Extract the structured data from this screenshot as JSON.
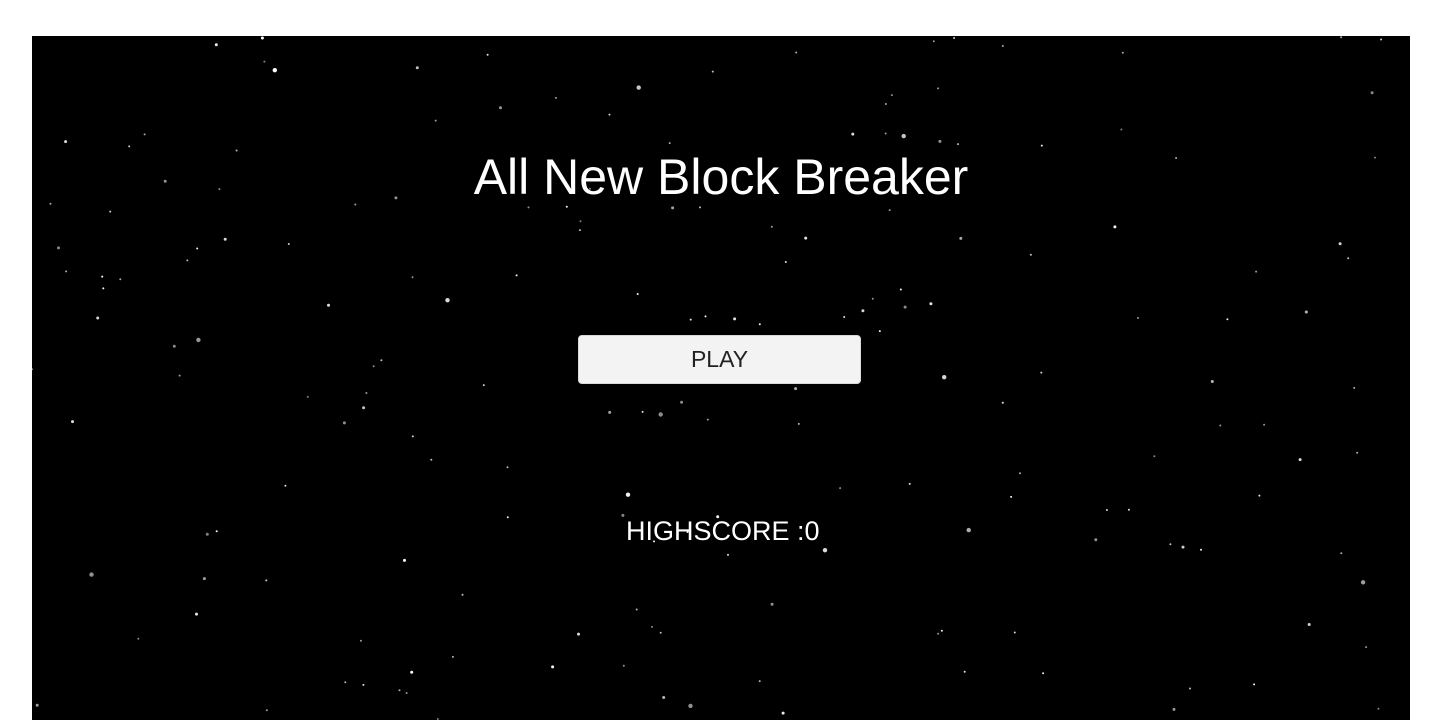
{
  "menu": {
    "title": "All New Block Breaker",
    "play_label": "PLAY",
    "highscore_text": "HIGHSCORE :0"
  },
  "colors": {
    "background": "#000000",
    "text": "#ffffff",
    "button_bg": "#f3f3f3",
    "button_text": "#222222"
  }
}
